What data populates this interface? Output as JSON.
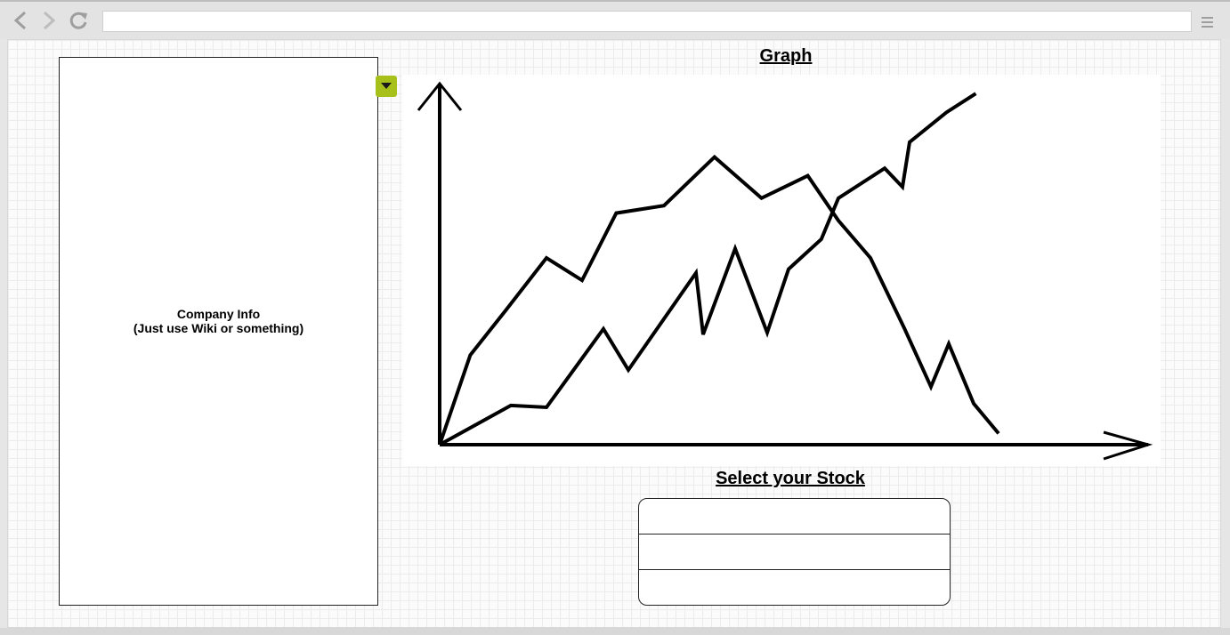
{
  "browser": {
    "back_icon": "chevron-left-icon",
    "forward_icon": "chevron-right-icon",
    "reload_icon": "reload-icon",
    "menu_icon": "hamburger-menu-icon",
    "address_value": ""
  },
  "company_info": {
    "line1": "Company Info",
    "line2": "(Just use Wiki or something)",
    "toggle_icon": "triangle-down-icon",
    "toggle_color": "#a8c11a"
  },
  "graph": {
    "title": "Graph",
    "chart_data": {
      "type": "line",
      "title": "Graph",
      "xlabel": "",
      "ylabel": "",
      "grid": false,
      "x": [
        0,
        0.43,
        0.93,
        1.5,
        2.2,
        2.97,
        3.55,
        4.28,
        4.95,
        5.5,
        6.2,
        6.97,
        7.62,
        8.4,
        9.1,
        9.45,
        9.9
      ],
      "series": [
        {
          "name": "",
          "values": [
            0,
            2.4,
            3.6,
            5.0,
            4.4,
            6.2,
            6.4,
            7.7,
            6.6,
            7.2,
            6.0,
            5.0,
            3.1,
            1.55,
            2.7,
            1.1,
            0.3
          ]
        },
        {
          "name": "",
          "values": [
            0,
            1.05,
            1.0,
            3.1,
            2.0,
            4.6,
            2.95,
            5.25,
            3.0,
            4.7,
            5.5,
            6.6,
            7.4,
            6.9,
            8.1,
            8.9,
            9.4
          ]
        }
      ],
      "series_x": [
        [
          0,
          0.43,
          0.93,
          1.5,
          2.0,
          2.48,
          3.15,
          3.86,
          4.52,
          5.17,
          5.6,
          6.05,
          6.53,
          6.9,
          7.15,
          7.5,
          7.85
        ],
        [
          0,
          1.0,
          1.5,
          2.3,
          2.65,
          3.6,
          3.7,
          4.15,
          4.6,
          4.9,
          5.36,
          5.6,
          6.25,
          6.5,
          6.6,
          7.12,
          7.53
        ]
      ]
    }
  },
  "stock_select": {
    "title": "Select your Stock",
    "options": [
      "",
      "",
      ""
    ]
  }
}
